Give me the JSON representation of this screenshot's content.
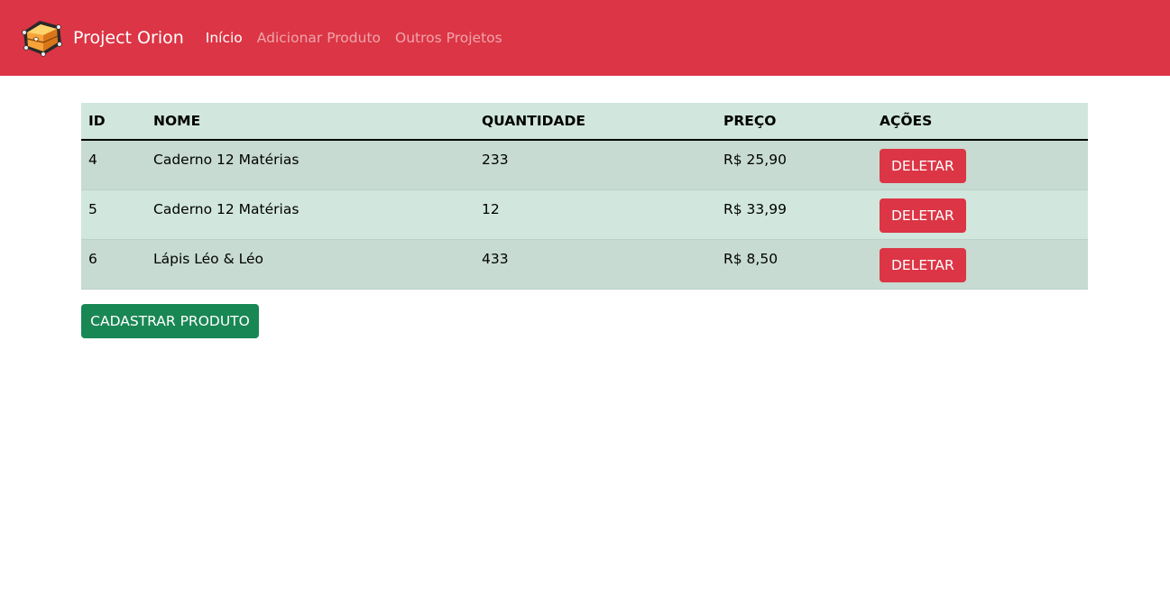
{
  "app": {
    "brand": "Project Orion",
    "logo_icon": "treasure-chest-icon"
  },
  "nav": {
    "items": [
      {
        "label": "Início",
        "active": true
      },
      {
        "label": "Adicionar Produto",
        "active": false
      },
      {
        "label": "Outros Projetos",
        "active": false
      }
    ]
  },
  "table": {
    "headers": [
      "ID",
      "NOME",
      "QUANTIDADE",
      "PREÇO",
      "AÇÕES"
    ],
    "rows": [
      {
        "id": "4",
        "nome": "Caderno 12 Matérias",
        "quantidade": "233",
        "preco": "R$ 25,90",
        "action": "DELETAR"
      },
      {
        "id": "5",
        "nome": "Caderno 12 Matérias",
        "quantidade": "12",
        "preco": "R$ 33,99",
        "action": "DELETAR"
      },
      {
        "id": "6",
        "nome": "Lápis Léo & Léo",
        "quantidade": "433",
        "preco": "R$ 8,50",
        "action": "DELETAR"
      }
    ]
  },
  "actions": {
    "add_label": "CADASTRAR PRODUTO"
  },
  "colors": {
    "navbar": "#dc3545",
    "table_bg": "#d1e7dd",
    "table_striped": "#c7dbd2",
    "danger": "#dc3545",
    "success": "#198754"
  }
}
